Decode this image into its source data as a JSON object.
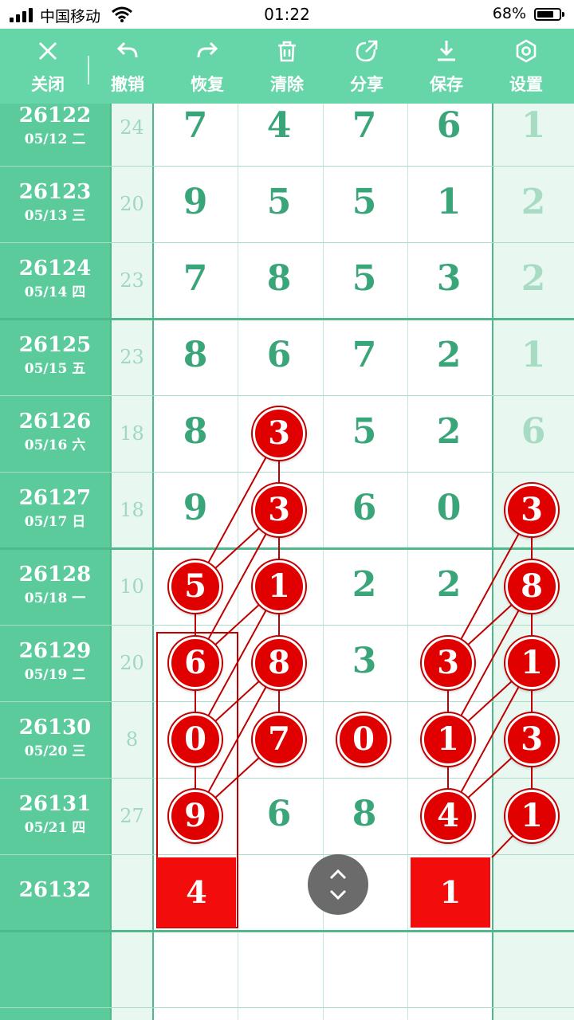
{
  "status_bar": {
    "carrier": "中国移动",
    "time": "01:22",
    "battery": "68%"
  },
  "toolbar": {
    "items": [
      {
        "label": "关闭",
        "icon": "close-icon"
      },
      {
        "label": "撤销",
        "icon": "undo-icon"
      },
      {
        "label": "恢复",
        "icon": "redo-icon"
      },
      {
        "label": "清除",
        "icon": "trash-icon"
      },
      {
        "label": "分享",
        "icon": "share-icon"
      },
      {
        "label": "保存",
        "icon": "download-icon"
      },
      {
        "label": "设置",
        "icon": "settings-icon"
      }
    ]
  },
  "rows": [
    {
      "issue": "26122",
      "date": "05/12 二",
      "sum": "24",
      "digits": [
        "7",
        "4",
        "7",
        "6",
        "1"
      ]
    },
    {
      "issue": "26123",
      "date": "05/13 三",
      "sum": "20",
      "digits": [
        "9",
        "5",
        "5",
        "1",
        "2"
      ]
    },
    {
      "issue": "26124",
      "date": "05/14 四",
      "sum": "23",
      "digits": [
        "7",
        "8",
        "5",
        "3",
        "2"
      ]
    },
    {
      "issue": "26125",
      "date": "05/15 五",
      "sum": "23",
      "digits": [
        "8",
        "6",
        "7",
        "2",
        "1"
      ]
    },
    {
      "issue": "26126",
      "date": "05/16 六",
      "sum": "18",
      "digits": [
        "8",
        "3",
        "5",
        "2",
        "6"
      ]
    },
    {
      "issue": "26127",
      "date": "05/17 日",
      "sum": "18",
      "digits": [
        "9",
        "3",
        "6",
        "0",
        "3"
      ]
    },
    {
      "issue": "26128",
      "date": "05/18 一",
      "sum": "10",
      "digits": [
        "5",
        "1",
        "2",
        "2",
        "8"
      ]
    },
    {
      "issue": "26129",
      "date": "05/19 二",
      "sum": "20",
      "digits": [
        "6",
        "8",
        "3",
        "3",
        "1"
      ]
    },
    {
      "issue": "26130",
      "date": "05/20 三",
      "sum": "8",
      "digits": [
        "0",
        "7",
        "0",
        "1",
        "3"
      ]
    },
    {
      "issue": "26131",
      "date": "05/21 四",
      "sum": "27",
      "digits": [
        "9",
        "6",
        "8",
        "4",
        "1"
      ]
    },
    {
      "issue": "26132",
      "date": "",
      "sum": "",
      "digits": [
        "",
        "",
        "",
        "",
        ""
      ]
    }
  ],
  "highlights": [
    [
      4,
      1
    ],
    [
      5,
      1
    ],
    [
      6,
      0
    ],
    [
      6,
      1
    ],
    [
      7,
      0
    ],
    [
      7,
      1
    ],
    [
      8,
      0
    ],
    [
      8,
      1
    ],
    [
      8,
      2
    ],
    [
      9,
      0
    ],
    [
      5,
      4
    ],
    [
      6,
      4
    ],
    [
      7,
      3
    ],
    [
      7,
      4
    ],
    [
      8,
      3
    ],
    [
      8,
      4
    ],
    [
      9,
      3
    ],
    [
      9,
      4
    ]
  ],
  "predictions": [
    {
      "col": 0,
      "value": "4"
    },
    {
      "col": 3,
      "value": "1"
    }
  ],
  "colors": {
    "toolbar": "#66D5A8",
    "issue_col": "#5CCB9C",
    "digit": "#3BA57A",
    "ball": "#E00000",
    "line": "#C00000"
  }
}
